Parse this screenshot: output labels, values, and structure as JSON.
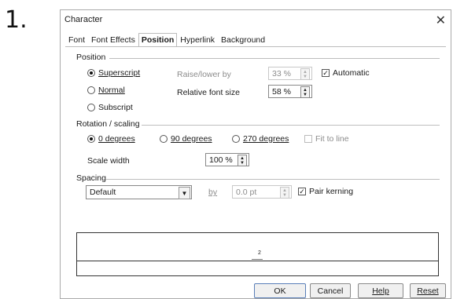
{
  "step_number": "1.",
  "window": {
    "title": "Character",
    "close_glyph": "✕"
  },
  "tabs": [
    {
      "label": "Font",
      "active": false
    },
    {
      "label": "Font Effects",
      "active": false
    },
    {
      "label": "Position",
      "active": true
    },
    {
      "label": "Hyperlink",
      "active": false
    },
    {
      "label": "Background",
      "active": false
    }
  ],
  "position_group": {
    "title": "Position",
    "superscript_label": "Superscript",
    "normal_label": "Normal",
    "subscript_label": "Subscript",
    "selected": "superscript",
    "raise_lower_label": "Raise/lower by",
    "raise_lower_value": "33 %",
    "automatic_label": "Automatic",
    "automatic_checked": true,
    "relative_font_size_label": "Relative font size",
    "relative_font_size_value": "58 %"
  },
  "rotation_group": {
    "title": "Rotation / scaling",
    "deg0_label": "0 degrees",
    "deg90_label": "90 degrees",
    "deg270_label": "270 degrees",
    "selected": "0",
    "fit_to_line_label": "Fit to line",
    "fit_to_line_checked": false,
    "scale_width_label": "Scale width",
    "scale_width_value": "100 %"
  },
  "spacing_group": {
    "title": "Spacing",
    "spacing_value": "Default",
    "by_label": "by",
    "by_value": "0.0 pt",
    "pair_kerning_label": "Pair kerning",
    "pair_kerning_checked": true
  },
  "preview": {
    "sample_text": "2"
  },
  "buttons": {
    "ok": "OK",
    "cancel": "Cancel",
    "help": "Help",
    "reset": "Reset"
  },
  "glyphs": {
    "check": "✓",
    "spin_up": "▲",
    "spin_down": "▼",
    "drop": "▼"
  }
}
